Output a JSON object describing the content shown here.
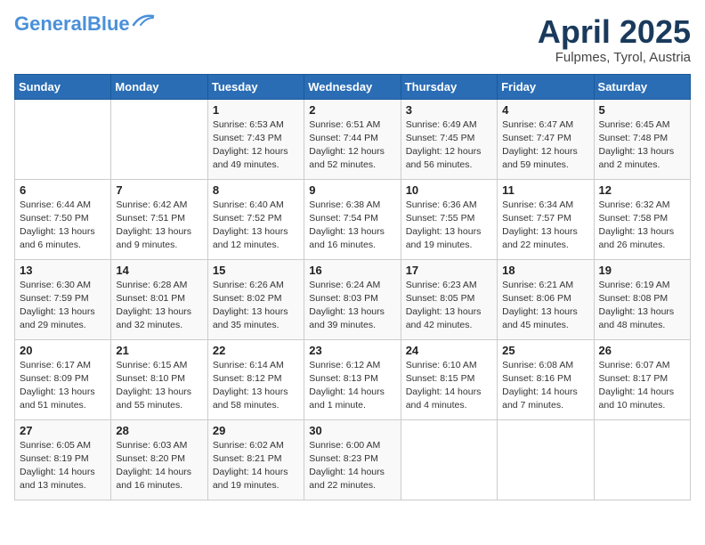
{
  "header": {
    "logo_line1": "General",
    "logo_line2": "Blue",
    "month": "April 2025",
    "location": "Fulpmes, Tyrol, Austria"
  },
  "days_of_week": [
    "Sunday",
    "Monday",
    "Tuesday",
    "Wednesday",
    "Thursday",
    "Friday",
    "Saturday"
  ],
  "weeks": [
    [
      {
        "day": "",
        "info": ""
      },
      {
        "day": "",
        "info": ""
      },
      {
        "day": "1",
        "info": "Sunrise: 6:53 AM\nSunset: 7:43 PM\nDaylight: 12 hours\nand 49 minutes."
      },
      {
        "day": "2",
        "info": "Sunrise: 6:51 AM\nSunset: 7:44 PM\nDaylight: 12 hours\nand 52 minutes."
      },
      {
        "day": "3",
        "info": "Sunrise: 6:49 AM\nSunset: 7:45 PM\nDaylight: 12 hours\nand 56 minutes."
      },
      {
        "day": "4",
        "info": "Sunrise: 6:47 AM\nSunset: 7:47 PM\nDaylight: 12 hours\nand 59 minutes."
      },
      {
        "day": "5",
        "info": "Sunrise: 6:45 AM\nSunset: 7:48 PM\nDaylight: 13 hours\nand 2 minutes."
      }
    ],
    [
      {
        "day": "6",
        "info": "Sunrise: 6:44 AM\nSunset: 7:50 PM\nDaylight: 13 hours\nand 6 minutes."
      },
      {
        "day": "7",
        "info": "Sunrise: 6:42 AM\nSunset: 7:51 PM\nDaylight: 13 hours\nand 9 minutes."
      },
      {
        "day": "8",
        "info": "Sunrise: 6:40 AM\nSunset: 7:52 PM\nDaylight: 13 hours\nand 12 minutes."
      },
      {
        "day": "9",
        "info": "Sunrise: 6:38 AM\nSunset: 7:54 PM\nDaylight: 13 hours\nand 16 minutes."
      },
      {
        "day": "10",
        "info": "Sunrise: 6:36 AM\nSunset: 7:55 PM\nDaylight: 13 hours\nand 19 minutes."
      },
      {
        "day": "11",
        "info": "Sunrise: 6:34 AM\nSunset: 7:57 PM\nDaylight: 13 hours\nand 22 minutes."
      },
      {
        "day": "12",
        "info": "Sunrise: 6:32 AM\nSunset: 7:58 PM\nDaylight: 13 hours\nand 26 minutes."
      }
    ],
    [
      {
        "day": "13",
        "info": "Sunrise: 6:30 AM\nSunset: 7:59 PM\nDaylight: 13 hours\nand 29 minutes."
      },
      {
        "day": "14",
        "info": "Sunrise: 6:28 AM\nSunset: 8:01 PM\nDaylight: 13 hours\nand 32 minutes."
      },
      {
        "day": "15",
        "info": "Sunrise: 6:26 AM\nSunset: 8:02 PM\nDaylight: 13 hours\nand 35 minutes."
      },
      {
        "day": "16",
        "info": "Sunrise: 6:24 AM\nSunset: 8:03 PM\nDaylight: 13 hours\nand 39 minutes."
      },
      {
        "day": "17",
        "info": "Sunrise: 6:23 AM\nSunset: 8:05 PM\nDaylight: 13 hours\nand 42 minutes."
      },
      {
        "day": "18",
        "info": "Sunrise: 6:21 AM\nSunset: 8:06 PM\nDaylight: 13 hours\nand 45 minutes."
      },
      {
        "day": "19",
        "info": "Sunrise: 6:19 AM\nSunset: 8:08 PM\nDaylight: 13 hours\nand 48 minutes."
      }
    ],
    [
      {
        "day": "20",
        "info": "Sunrise: 6:17 AM\nSunset: 8:09 PM\nDaylight: 13 hours\nand 51 minutes."
      },
      {
        "day": "21",
        "info": "Sunrise: 6:15 AM\nSunset: 8:10 PM\nDaylight: 13 hours\nand 55 minutes."
      },
      {
        "day": "22",
        "info": "Sunrise: 6:14 AM\nSunset: 8:12 PM\nDaylight: 13 hours\nand 58 minutes."
      },
      {
        "day": "23",
        "info": "Sunrise: 6:12 AM\nSunset: 8:13 PM\nDaylight: 14 hours\nand 1 minute."
      },
      {
        "day": "24",
        "info": "Sunrise: 6:10 AM\nSunset: 8:15 PM\nDaylight: 14 hours\nand 4 minutes."
      },
      {
        "day": "25",
        "info": "Sunrise: 6:08 AM\nSunset: 8:16 PM\nDaylight: 14 hours\nand 7 minutes."
      },
      {
        "day": "26",
        "info": "Sunrise: 6:07 AM\nSunset: 8:17 PM\nDaylight: 14 hours\nand 10 minutes."
      }
    ],
    [
      {
        "day": "27",
        "info": "Sunrise: 6:05 AM\nSunset: 8:19 PM\nDaylight: 14 hours\nand 13 minutes."
      },
      {
        "day": "28",
        "info": "Sunrise: 6:03 AM\nSunset: 8:20 PM\nDaylight: 14 hours\nand 16 minutes."
      },
      {
        "day": "29",
        "info": "Sunrise: 6:02 AM\nSunset: 8:21 PM\nDaylight: 14 hours\nand 19 minutes."
      },
      {
        "day": "30",
        "info": "Sunrise: 6:00 AM\nSunset: 8:23 PM\nDaylight: 14 hours\nand 22 minutes."
      },
      {
        "day": "",
        "info": ""
      },
      {
        "day": "",
        "info": ""
      },
      {
        "day": "",
        "info": ""
      }
    ]
  ]
}
